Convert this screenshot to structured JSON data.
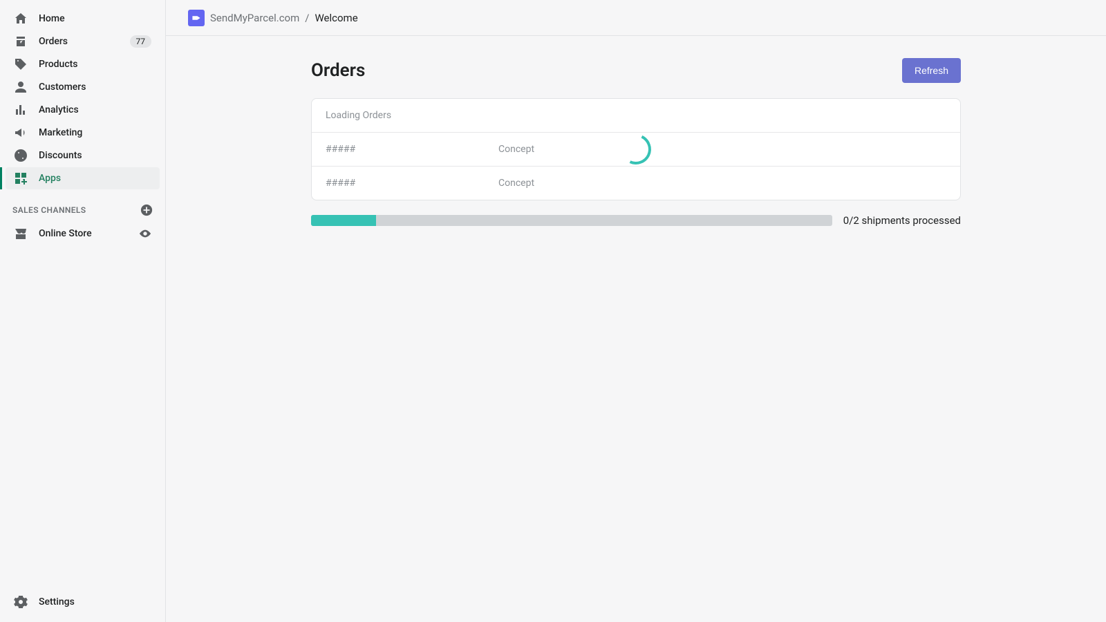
{
  "sidebar": {
    "items": [
      {
        "label": "Home",
        "icon": "home"
      },
      {
        "label": "Orders",
        "icon": "orders",
        "badge": "77"
      },
      {
        "label": "Products",
        "icon": "products"
      },
      {
        "label": "Customers",
        "icon": "customers"
      },
      {
        "label": "Analytics",
        "icon": "analytics"
      },
      {
        "label": "Marketing",
        "icon": "marketing"
      },
      {
        "label": "Discounts",
        "icon": "discounts"
      },
      {
        "label": "Apps",
        "icon": "apps",
        "active": true
      }
    ],
    "channels_header": "SALES CHANNELS",
    "channels": [
      {
        "label": "Online Store",
        "icon": "store"
      }
    ],
    "settings_label": "Settings"
  },
  "breadcrumb": {
    "app": "SendMyParcel.com",
    "sep": "/",
    "page": "Welcome"
  },
  "page": {
    "title": "Orders",
    "refresh_label": "Refresh",
    "loading_label": "Loading Orders",
    "rows": [
      {
        "id": "#####",
        "status": "Concept"
      },
      {
        "id": "#####",
        "status": "Concept"
      }
    ],
    "progress_label": "0/2 shipments processed"
  }
}
